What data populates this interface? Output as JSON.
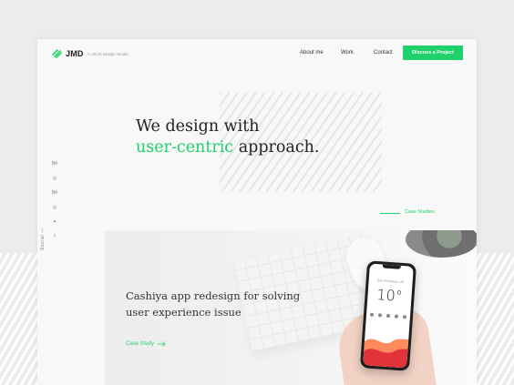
{
  "header": {
    "logo_text": "JMD",
    "tagline": "A UI/UX Design Studio",
    "nav": [
      "About me",
      "Work",
      "Contact"
    ],
    "cta_label": "Discuss a Project"
  },
  "hero": {
    "line1": "We design with",
    "line2_accent": "user-centric",
    "line2_rest": " approach."
  },
  "case_studies_link": "Case Studies",
  "social": {
    "label": "Social",
    "icons": [
      "behance-icon",
      "dribbble-icon",
      "behance-icon",
      "dribbble-icon",
      "twitter-icon",
      "facebook-icon"
    ]
  },
  "case_card": {
    "title_line1": "Cashiya app redesign for solving",
    "title_line2": "user experience issue",
    "link_label": "Case Study"
  },
  "phone": {
    "city": "San Francisco, US",
    "temperature": "10°"
  },
  "colors": {
    "accent": "#1fd16a",
    "background": "#ececec",
    "page": "#f8f8f8"
  }
}
